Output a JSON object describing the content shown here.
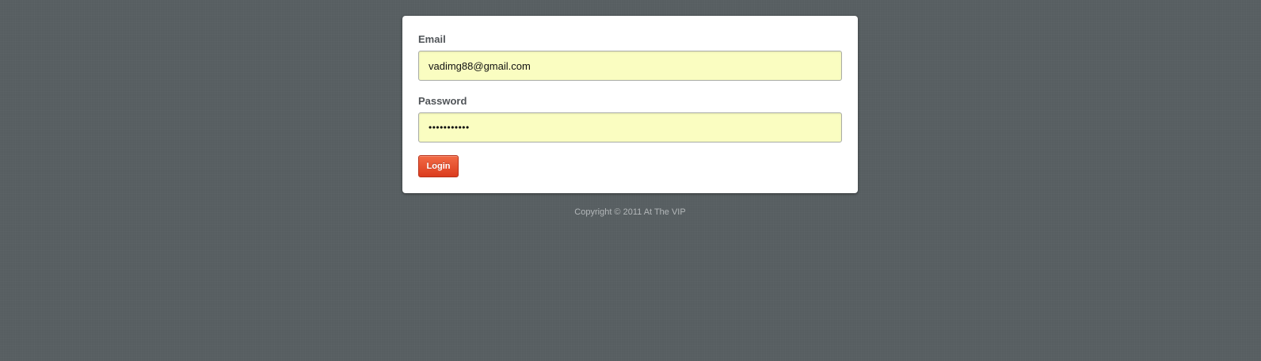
{
  "login_form": {
    "email": {
      "label": "Email",
      "value": "vadimg88@gmail.com"
    },
    "password": {
      "label": "Password",
      "value": "passwordxxx"
    },
    "login_button_label": "Login"
  },
  "footer": {
    "copyright": "Copyright © 2011 At The VIP"
  },
  "colors": {
    "background": "#575e61",
    "input_background": "#fafdc1",
    "button_accent": "#e24a2b"
  }
}
